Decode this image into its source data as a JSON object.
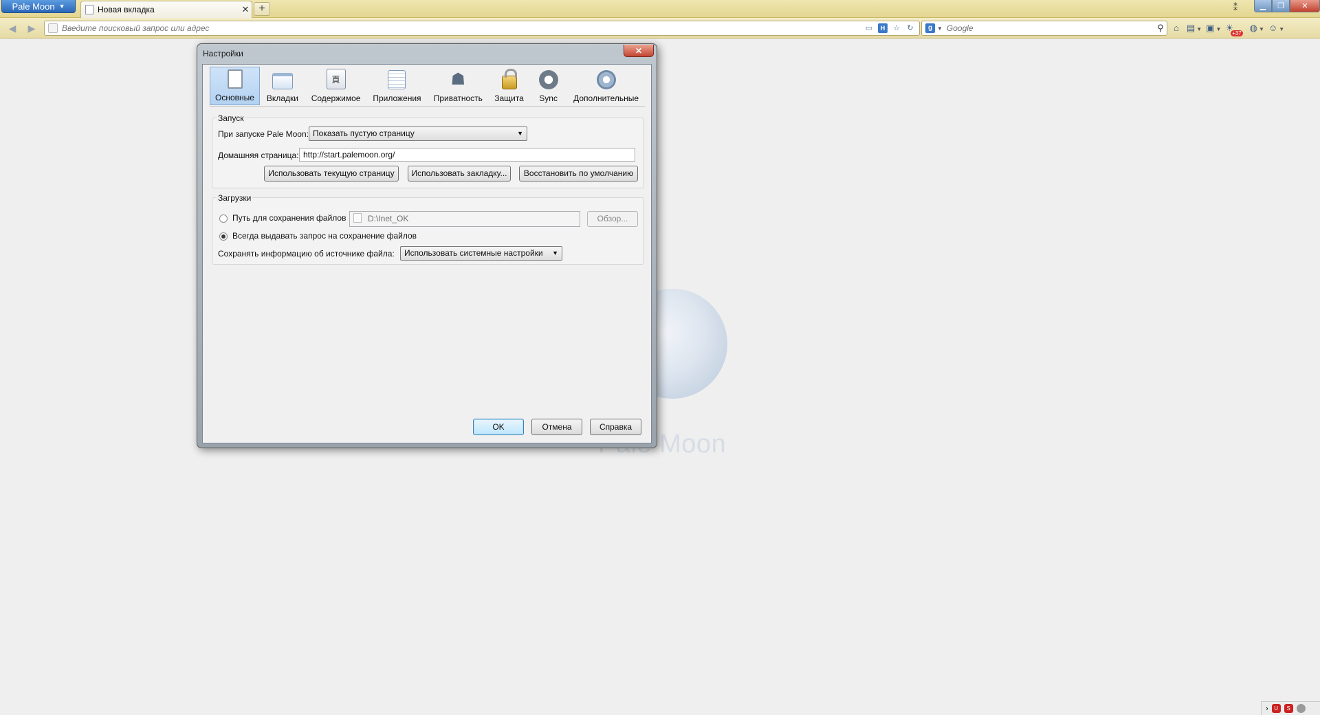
{
  "browser": {
    "app_button_label": "Pale Moon",
    "tab_title": "Новая вкладка",
    "newtab_symbol": "+",
    "url_placeholder": "Введите поисковый запрос или адрес",
    "search_placeholder": "Google",
    "search_engine_letter": "g",
    "notification_count": "+37"
  },
  "dialog": {
    "title": "Настройки",
    "panes": [
      {
        "label": "Основные",
        "icon": "general-icon"
      },
      {
        "label": "Вкладки",
        "icon": "tabs-icon"
      },
      {
        "label": "Содержимое",
        "icon": "content-icon"
      },
      {
        "label": "Приложения",
        "icon": "applications-icon"
      },
      {
        "label": "Приватность",
        "icon": "privacy-mask-icon"
      },
      {
        "label": "Защита",
        "icon": "padlock-icon"
      },
      {
        "label": "Sync",
        "icon": "sync-icon"
      },
      {
        "label": "Дополнительные",
        "icon": "gear-icon"
      }
    ],
    "selected_pane": "Основные",
    "startup": {
      "group_label": "Запуск",
      "when_starts_label": "При запуске Pale Moon:",
      "when_starts_value": "Показать пустую страницу",
      "home_page_label": "Домашняя страница:",
      "home_page_value": "http://start.palemoon.org/",
      "use_current_button": "Использовать текущую страницу",
      "use_bookmark_button": "Использовать закладку...",
      "restore_default_button": "Восстановить по умолчанию"
    },
    "downloads": {
      "group_label": "Загрузки",
      "save_to_label": "Путь для сохранения файлов",
      "save_to_path": "D:\\Inet_OK",
      "browse_button": "Обзор...",
      "always_ask_label": "Всегда выдавать запрос на сохранение файлов",
      "source_info_label": "Сохранять информацию об источнике файла:",
      "source_info_value": "Использовать системные настройки",
      "selected_option": "always_ask"
    },
    "buttons": {
      "ok": "OK",
      "cancel": "Отмена",
      "help": "Справка"
    }
  },
  "background": {
    "logo_text": "Pale Moon"
  },
  "colors": {
    "tabbar": "#e4d690",
    "app_button": "#2b67b8",
    "close_red": "#c44531",
    "selected_pane": "#b3d2f2"
  }
}
